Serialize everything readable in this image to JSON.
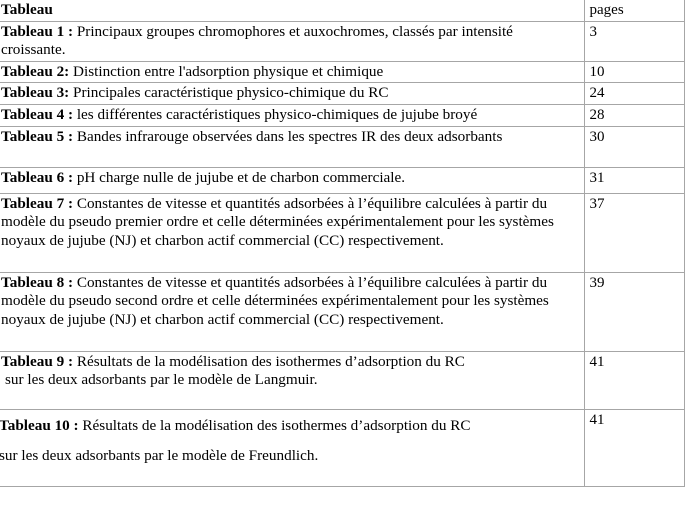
{
  "document": {
    "type": "list-of-tables",
    "columns": {
      "label_header": "Tableau",
      "page_header": "pages"
    },
    "rows": [
      {
        "id": "tableau-1",
        "label_bold": "Tableau 1 :",
        "label_rest": " Principaux groupes chromophores et auxochromes, classés par intensité croissante.",
        "page": "3"
      },
      {
        "id": "tableau-2",
        "label_bold": "Tableau 2:",
        "label_rest": " Distinction entre l'adsorption physique et chimique",
        "page": "10"
      },
      {
        "id": "tableau-3",
        "label_bold": "Tableau 3:",
        "label_rest": " Principales caractéristique physico-chimique du RC",
        "page": "24"
      },
      {
        "id": "tableau-4",
        "label_bold": "Tableau 4 :",
        "label_rest": " les différentes caractéristiques physico-chimiques de jujube broyé",
        "page": "28"
      },
      {
        "id": "tableau-5",
        "label_bold": "Tableau 5 :",
        "label_rest": " Bandes infrarouge observées dans les spectres IR des deux adsorbants",
        "page": "30"
      },
      {
        "id": "tableau-6",
        "label_bold": "Tableau 6 :",
        "label_rest": " pH charge nulle de jujube et de charbon commerciale.",
        "page": "31"
      },
      {
        "id": "tableau-7",
        "label_bold": "Tableau 7 :",
        "label_rest": " Constantes de vitesse et quantités adsorbées à l’équilibre calculées à partir du modèle du pseudo premier ordre et celle déterminées expérimentalement pour les systèmes noyaux de jujube (NJ) et charbon actif commercial (CC) respectivement.",
        "page": "37"
      },
      {
        "id": "tableau-8",
        "label_bold": "Tableau 8 :",
        "label_rest": " Constantes de vitesse et quantités adsorbées à l’équilibre calculées à partir du modèle du pseudo second ordre et celle déterminées expérimentalement pour les systèmes noyaux de jujube (NJ) et charbon actif commercial (CC) respectivement.",
        "page": "39"
      },
      {
        "id": "tableau-9",
        "label_bold": "Tableau 9 :",
        "label_rest": " Résultats de la modélisation des isothermes d’adsorption du RC",
        "label_line2": "sur les deux adsorbants  par le modèle de Langmuir.",
        "page": "41"
      },
      {
        "id": "tableau-10",
        "label_bold": "Tableau 10 :",
        "label_rest": " Résultats de la modélisation des isothermes d’adsorption du RC",
        "label_line2": "sur les deux adsorbants par le modèle de Freundlich.",
        "page": "41"
      }
    ]
  },
  "colors": {
    "page_background": "#ffffff",
    "text": "#000000",
    "border": "#a6a6a6"
  }
}
